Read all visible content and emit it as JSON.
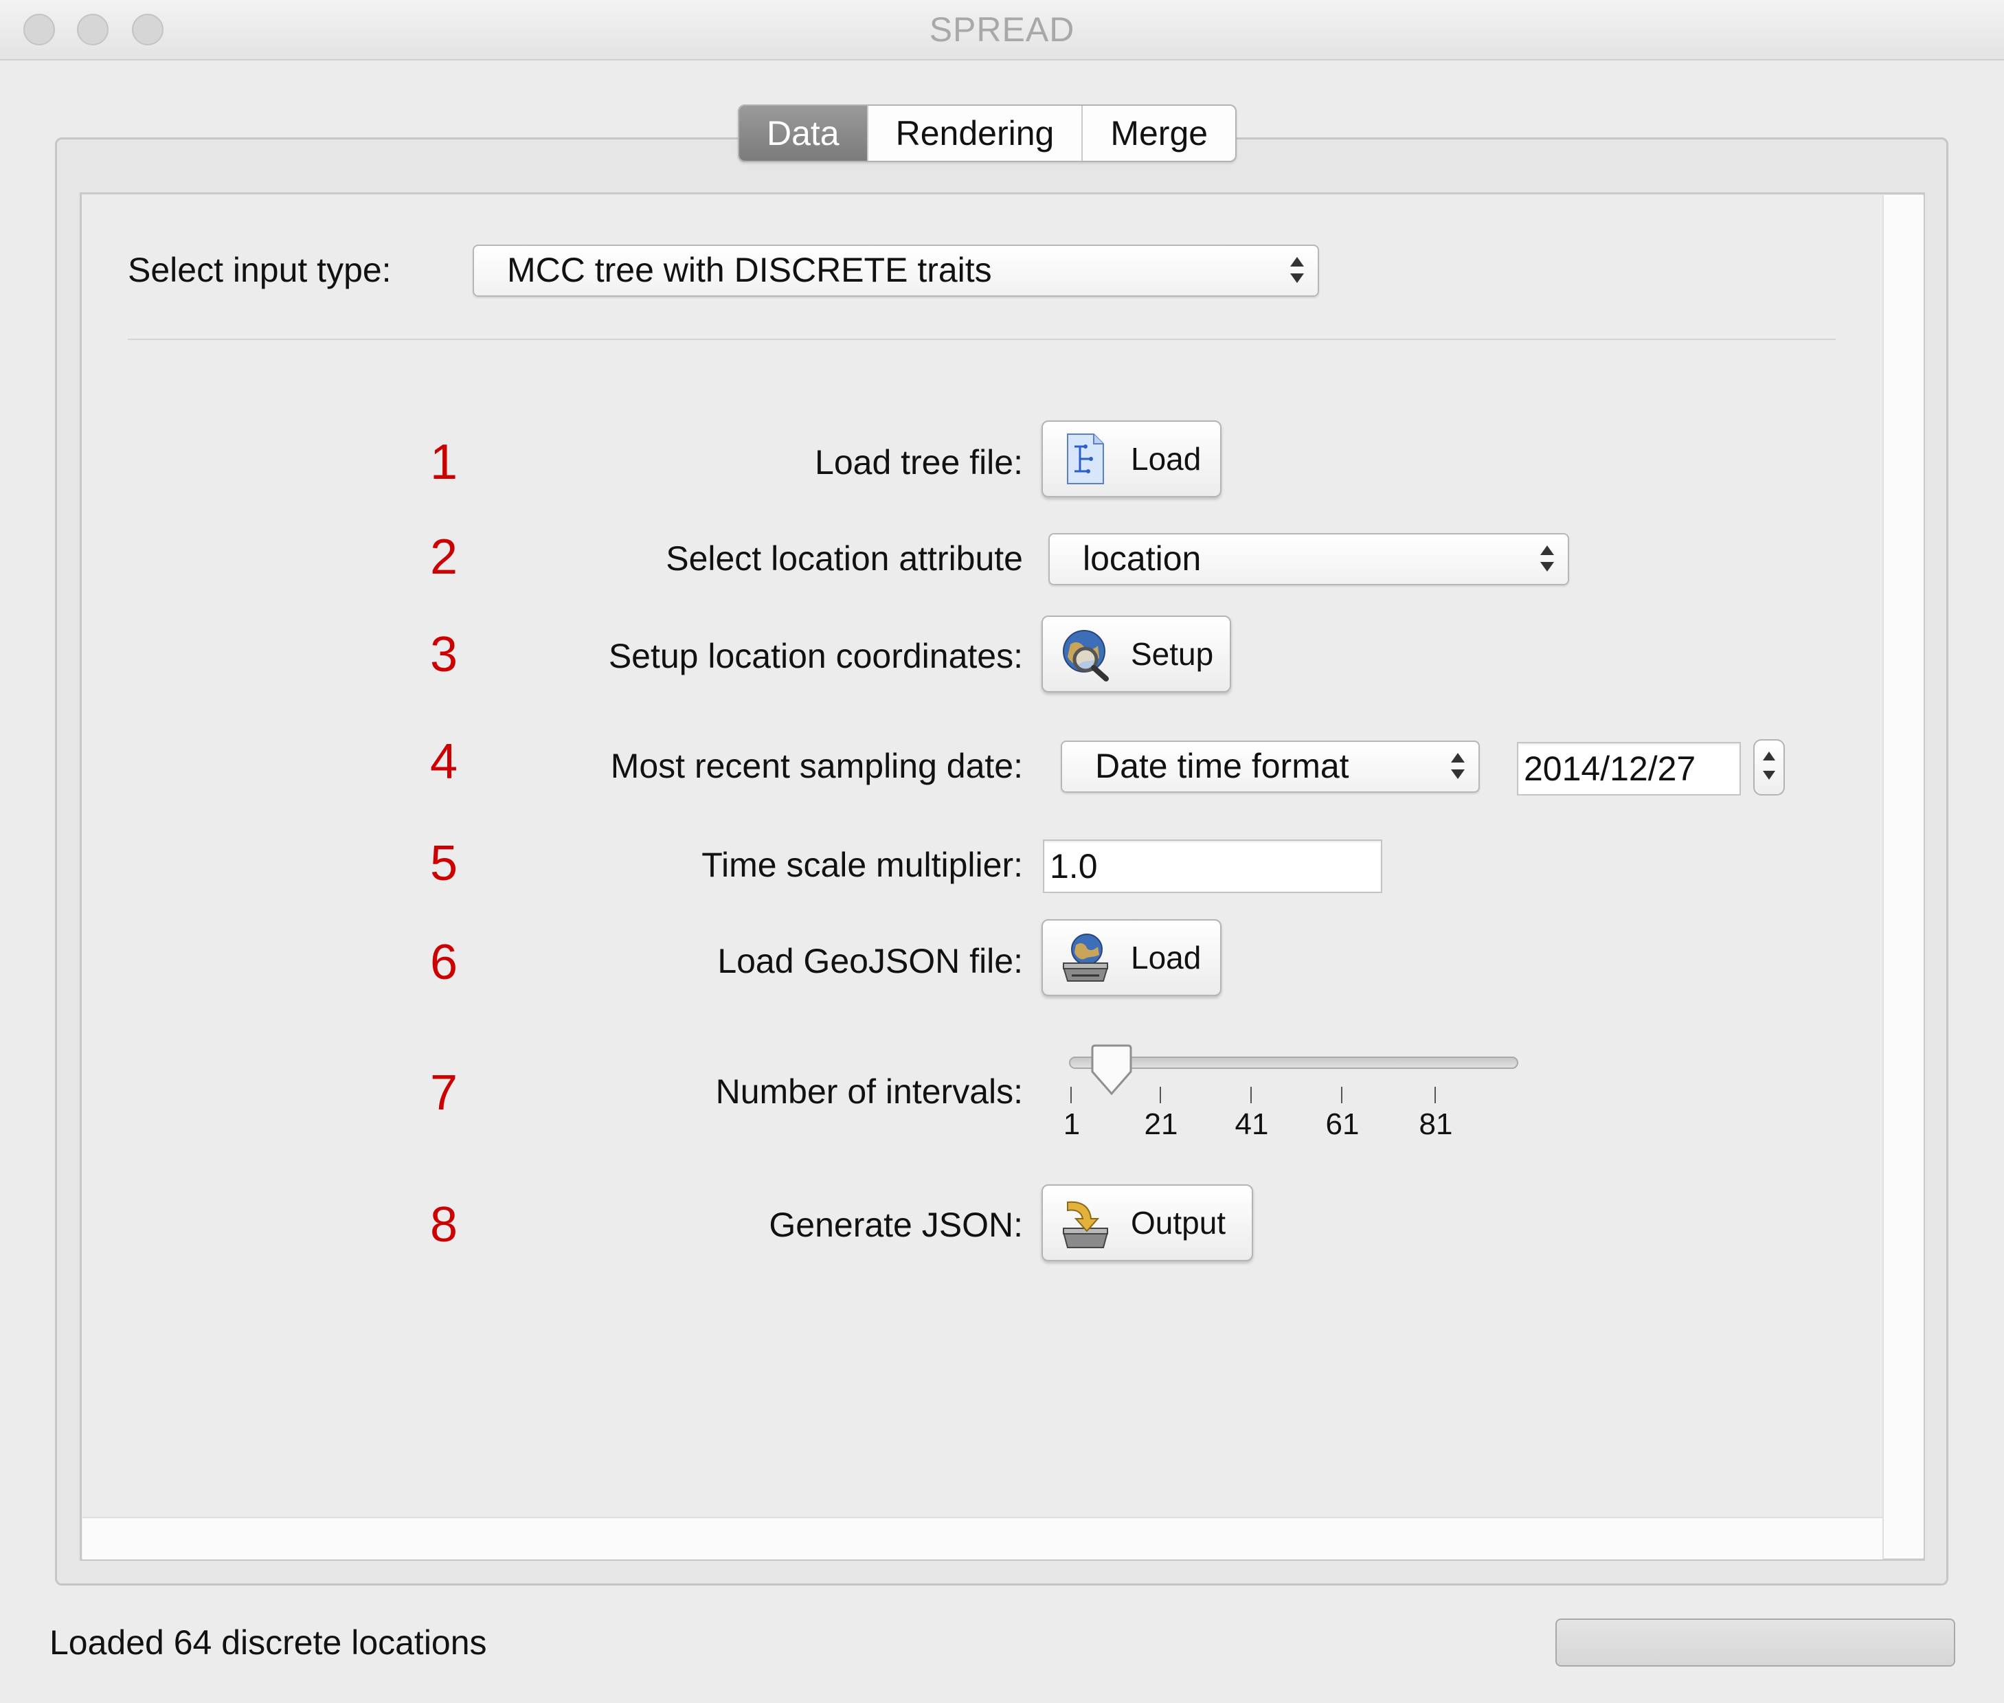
{
  "window": {
    "title": "SPREAD"
  },
  "tabs": [
    {
      "label": "Data",
      "selected": true
    },
    {
      "label": "Rendering",
      "selected": false
    },
    {
      "label": "Merge",
      "selected": false
    }
  ],
  "input_type": {
    "label": "Select input type:",
    "value": "MCC tree with DISCRETE traits"
  },
  "steps": {
    "s1": {
      "num": "1",
      "label": "Load tree file:",
      "button": "Load",
      "icon": "tree-file-icon"
    },
    "s2": {
      "num": "2",
      "label": "Select location attribute",
      "value": "location"
    },
    "s3": {
      "num": "3",
      "label": "Setup location coordinates:",
      "button": "Setup",
      "icon": "globe-magnifier-icon"
    },
    "s4": {
      "num": "4",
      "label": "Most recent sampling date:",
      "format": "Date time format",
      "date": "2014/12/27"
    },
    "s5": {
      "num": "5",
      "label": "Time scale multiplier:",
      "value": "1.0"
    },
    "s6": {
      "num": "6",
      "label": "Load GeoJSON file:",
      "button": "Load",
      "icon": "globe-drive-icon"
    },
    "s7": {
      "num": "7",
      "label": "Number of intervals:",
      "ticks": [
        "1",
        "21",
        "41",
        "61",
        "81"
      ],
      "value": 10
    },
    "s8": {
      "num": "8",
      "label": "Generate JSON:",
      "button": "Output",
      "icon": "output-arrow-icon"
    }
  },
  "status": {
    "text": "Loaded 64 discrete locations",
    "progress": 0
  },
  "colors": {
    "step_number": "#cc0000",
    "selected_tab": "#8a8a8a"
  }
}
